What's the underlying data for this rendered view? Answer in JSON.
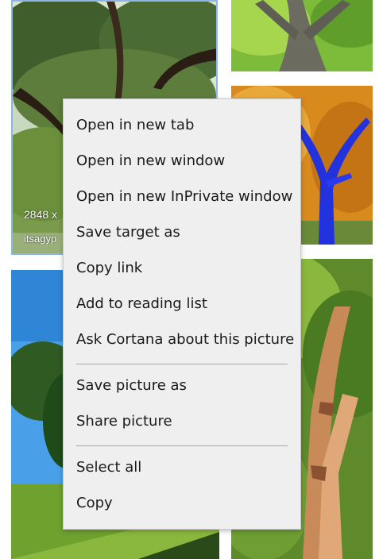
{
  "tiles": {
    "first": {
      "dimensions_text": "2848 x",
      "source_text": "itsagyp"
    }
  },
  "context_menu": {
    "items": [
      {
        "label": "Open in new tab"
      },
      {
        "label": "Open in new window"
      },
      {
        "label": "Open in new InPrivate window"
      },
      {
        "label": "Save target as"
      },
      {
        "label": "Copy link"
      },
      {
        "label": "Add to reading list"
      },
      {
        "label": "Ask Cortana about this picture"
      },
      {
        "label": "Save picture as"
      },
      {
        "label": "Share picture"
      },
      {
        "label": "Select all"
      },
      {
        "label": "Copy"
      }
    ]
  },
  "colors": {
    "menu_background": "#efefef",
    "selected_tile_border": "#8fb4e8",
    "separator": "#a8a8a8"
  }
}
